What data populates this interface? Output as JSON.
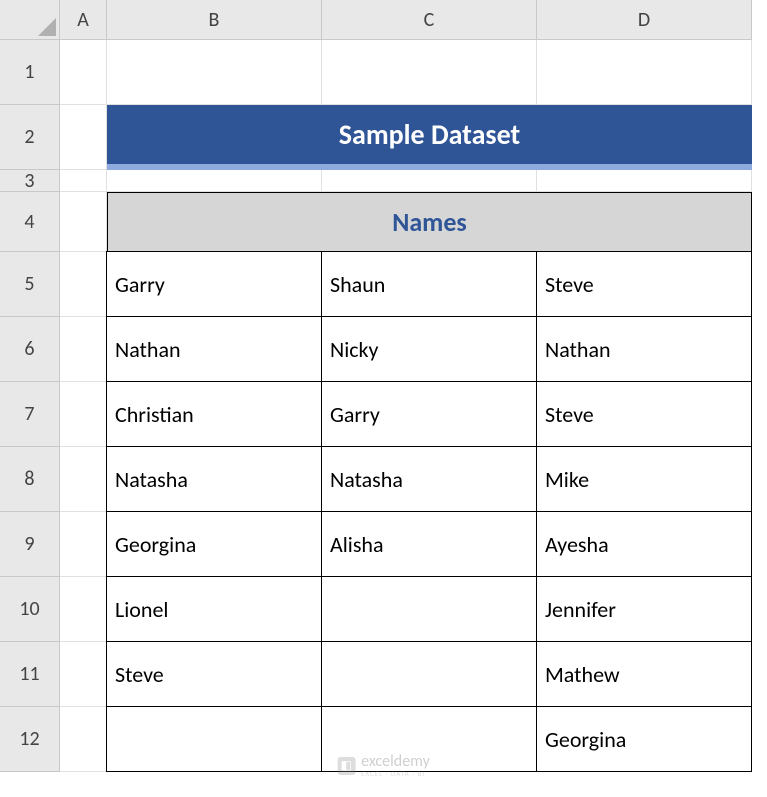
{
  "columns": [
    "A",
    "B",
    "C",
    "D"
  ],
  "rows": [
    "1",
    "2",
    "3",
    "4",
    "5",
    "6",
    "7",
    "8",
    "9",
    "10",
    "11",
    "12"
  ],
  "title": "Sample Dataset",
  "table_header": "Names",
  "data": {
    "r5": {
      "B": "Garry",
      "C": "Shaun",
      "D": "Steve"
    },
    "r6": {
      "B": "Nathan",
      "C": "Nicky",
      "D": "Nathan"
    },
    "r7": {
      "B": "Christian",
      "C": "Garry",
      "D": "Steve"
    },
    "r8": {
      "B": "Natasha",
      "C": "Natasha",
      "D": "Mike"
    },
    "r9": {
      "B": "Georgina",
      "C": "Alisha",
      "D": "Ayesha"
    },
    "r10": {
      "B": "Lionel",
      "C": "",
      "D": "Jennifer"
    },
    "r11": {
      "B": "Steve",
      "C": "",
      "D": "Mathew"
    },
    "r12": {
      "B": "",
      "C": "",
      "D": "Georgina"
    }
  },
  "watermark": {
    "main": "exceldemy",
    "sub": "EXCEL · DATA · BI"
  }
}
